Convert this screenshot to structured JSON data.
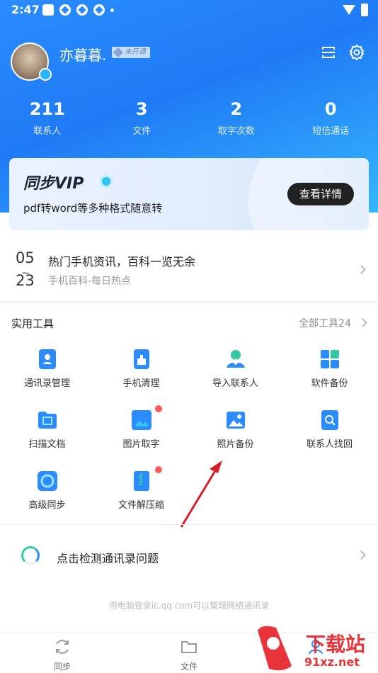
{
  "status": {
    "time": "2:47"
  },
  "profile": {
    "name": "亦暮暮.",
    "vip_status": "未开通"
  },
  "stats": [
    {
      "value": "211",
      "label": "联系人"
    },
    {
      "value": "3",
      "label": "文件"
    },
    {
      "value": "2",
      "label": "取字次数"
    },
    {
      "value": "0",
      "label": "短信通话"
    }
  ],
  "vip_card": {
    "title": "同步VIP",
    "subtitle": "pdf转word等多种格式随意转",
    "button": "查看详情"
  },
  "news": {
    "date_top": "05",
    "date_sep": "~",
    "date_bottom": "23",
    "title": "热门手机资讯，百科一览无余",
    "subtitle": "手机百科-每日热点"
  },
  "tools": {
    "heading": "实用工具",
    "all_label": "全部工具24",
    "items": [
      {
        "label": "通讯录管理",
        "icon": "contacts-book-icon",
        "color": "#2a8cff"
      },
      {
        "label": "手机清理",
        "icon": "phone-clean-icon",
        "color": "#2a8cff"
      },
      {
        "label": "导入联系人",
        "icon": "import-contact-icon",
        "color": "#2a8cff"
      },
      {
        "label": "软件备份",
        "icon": "app-backup-icon",
        "color": "#2a8cff"
      },
      {
        "label": "扫描文档",
        "icon": "scan-doc-icon",
        "color": "#2a8cff"
      },
      {
        "label": "图片取字",
        "icon": "image-text-icon",
        "color": "#2a8cff"
      },
      {
        "label": "照片备份",
        "icon": "photo-backup-icon",
        "color": "#2a8cff"
      },
      {
        "label": "联系人找回",
        "icon": "contact-recover-icon",
        "color": "#2a8cff"
      },
      {
        "label": "高级同步",
        "icon": "advanced-sync-icon",
        "color": "#2a8cff"
      },
      {
        "label": "文件解压缩",
        "icon": "unzip-icon",
        "color": "#2a8cff"
      }
    ]
  },
  "check": {
    "label": "点击检测通讯录问题"
  },
  "hint": "用电脑登录ic.qq.com可以管理网络通讯录",
  "nav": [
    {
      "label": "同步",
      "icon": "sync-icon"
    },
    {
      "label": "文件",
      "icon": "folder-icon"
    }
  ],
  "watermark": {
    "brand": "下载站",
    "domain": "91xz.net"
  }
}
